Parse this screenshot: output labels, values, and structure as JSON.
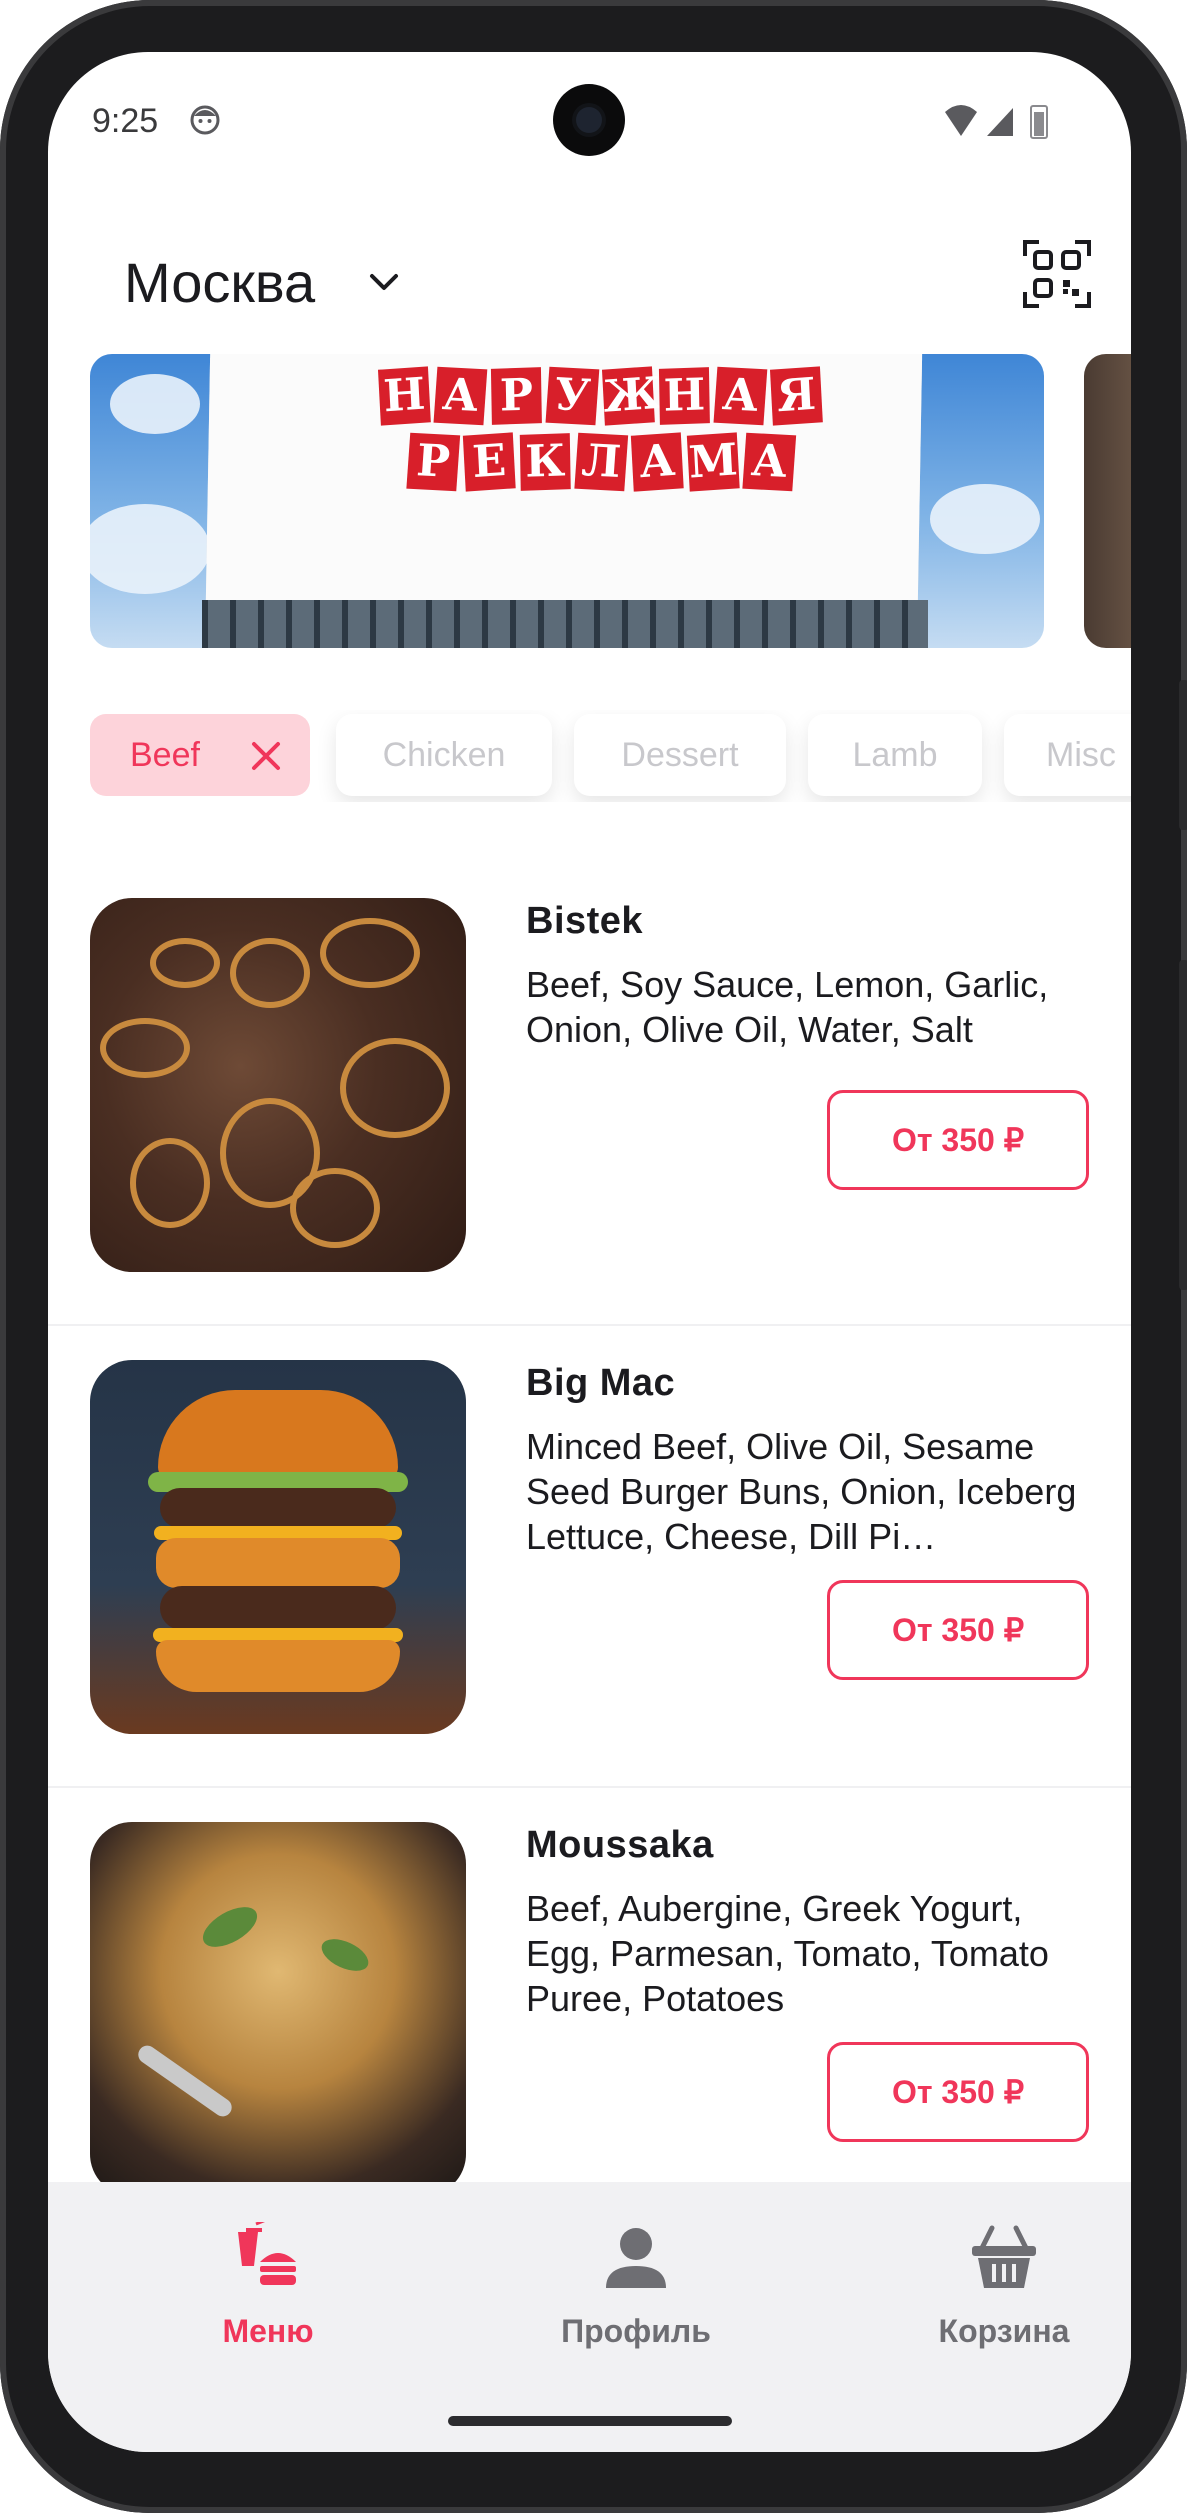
{
  "status_bar": {
    "time": "9:25",
    "icons": [
      "face-icon",
      "wifi-icon",
      "signal-icon",
      "battery-icon"
    ]
  },
  "header": {
    "city": "Москва",
    "icons": [
      "chevron-down-icon",
      "qr-code-icon"
    ]
  },
  "banner": {
    "lines": [
      "НАРУЖНАЯ",
      "РЕКЛАМА"
    ]
  },
  "categories": [
    {
      "label": "Beef",
      "active": true
    },
    {
      "label": "Chicken",
      "active": false
    },
    {
      "label": "Dessert",
      "active": false
    },
    {
      "label": "Lamb",
      "active": false
    },
    {
      "label": "Misc",
      "active": false
    }
  ],
  "menu": [
    {
      "name": "Bistek",
      "description": "Beef, Soy Sauce, Lemon, Garlic, Onion, Olive Oil, Water, Salt",
      "price": "От 350 ₽"
    },
    {
      "name": "Big Mac",
      "description": "Minced Beef, Olive Oil, Sesame Seed Burger Buns, Onion, Iceberg Lettuce, Cheese, Dill Pi…",
      "price": "От 350 ₽"
    },
    {
      "name": "Moussaka",
      "description": "Beef, Aubergine, Greek Yogurt, Egg, Parmesan, Tomato, Tomato Puree, Potatoes",
      "price": "От 350 ₽"
    }
  ],
  "nav": [
    {
      "label": "Меню",
      "icon": "fastfood-icon",
      "active": true
    },
    {
      "label": "Профиль",
      "icon": "person-icon",
      "active": false
    },
    {
      "label": "Корзина",
      "icon": "basket-icon",
      "active": false
    }
  ],
  "colors": {
    "accent": "#f0365a",
    "chip_active_bg": "#fdd3da",
    "nav_bg": "#f1f1f3"
  }
}
